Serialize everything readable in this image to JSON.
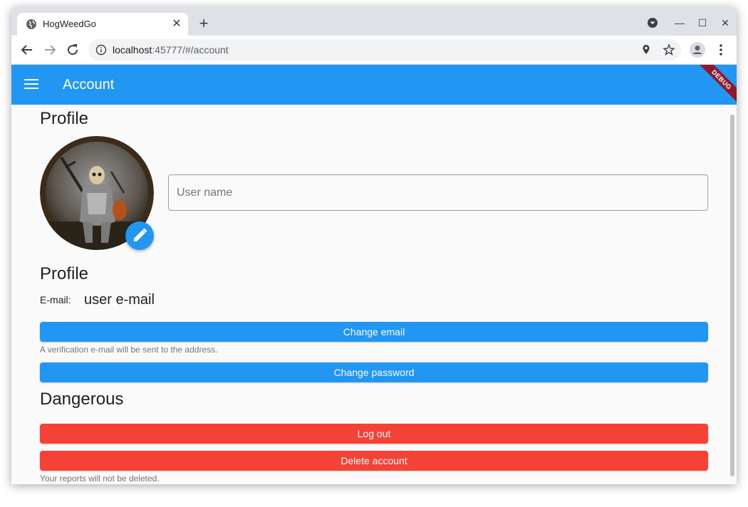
{
  "browser": {
    "tab_title": "HogWeedGo",
    "url_host": "localhost",
    "url_path": ":45777/#/account"
  },
  "appbar": {
    "title": "Account",
    "debug_banner": "DEBUG",
    "color": "#2196f3"
  },
  "profile": {
    "section_title": "Profile",
    "username_placeholder": "User name"
  },
  "account": {
    "section_title": "Profile",
    "email_label": "E-mail:",
    "email_value": "user e-mail",
    "change_email_label": "Change email",
    "change_email_hint": "A verification e-mail will be sent to the address.",
    "change_password_label": "Change password"
  },
  "dangerous": {
    "section_title": "Dangerous",
    "logout_label": "Log out",
    "delete_label": "Delete account",
    "delete_hint": "Your reports will not be deleted.",
    "color": "#f44336"
  }
}
